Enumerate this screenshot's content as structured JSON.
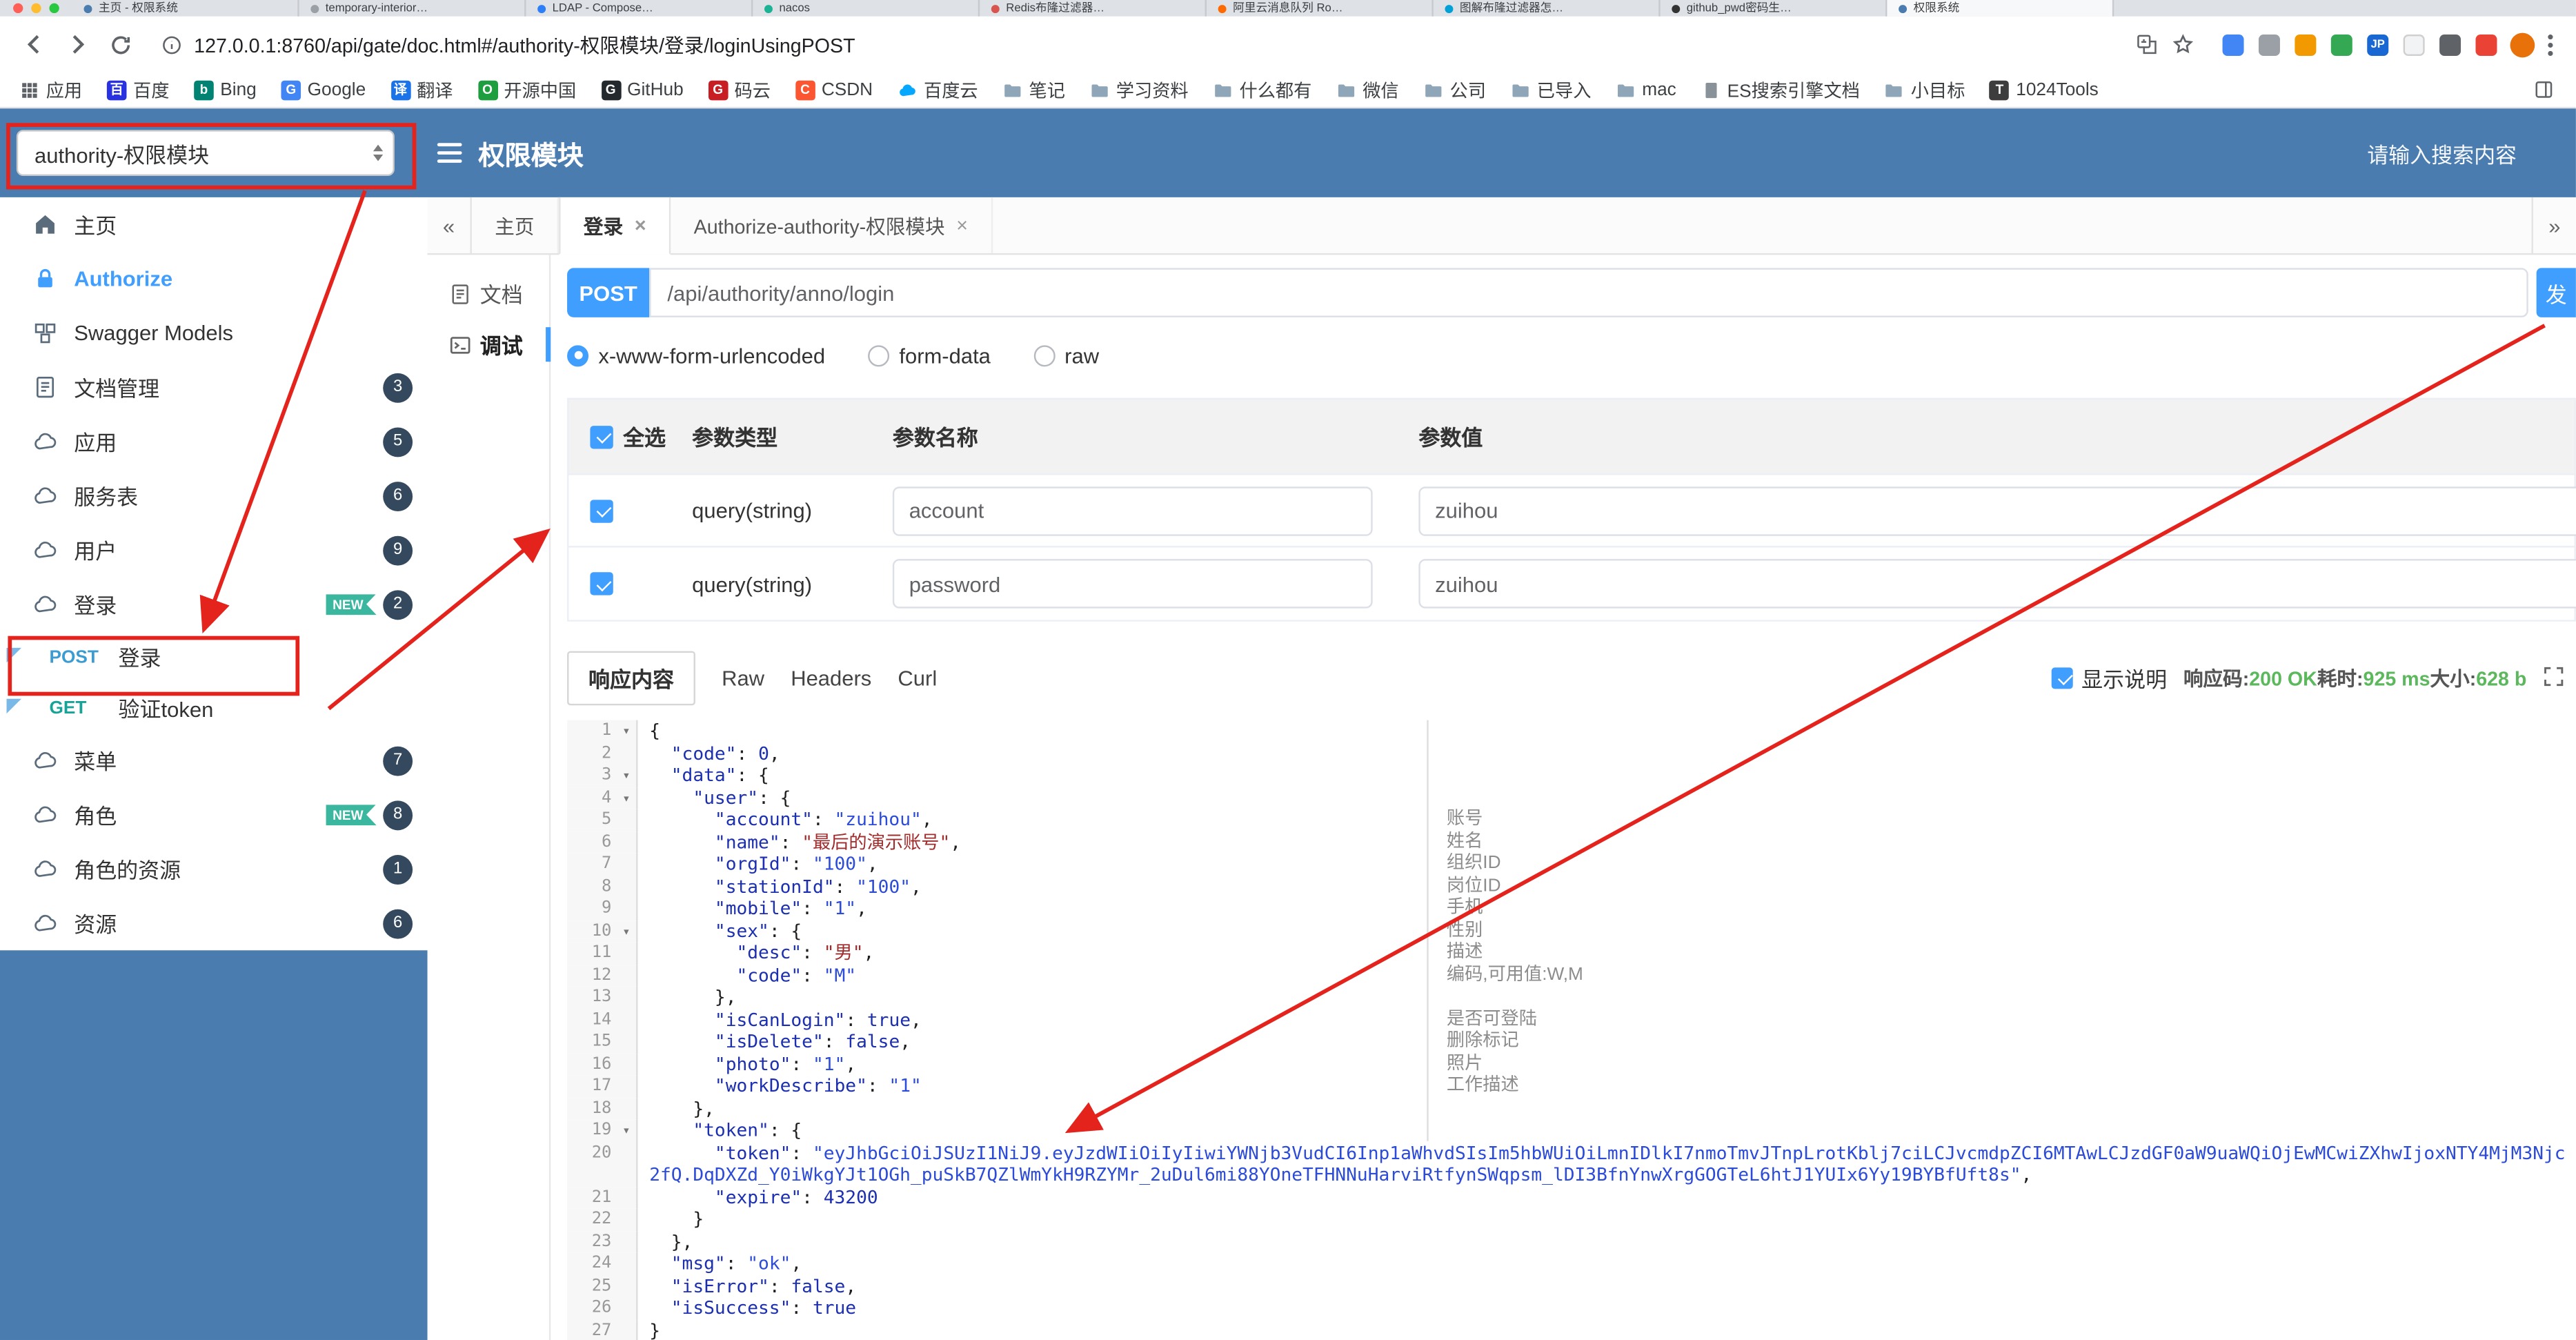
{
  "colors": {
    "accent": "#409eff",
    "header": "#4a7caf",
    "badge": "#35495e",
    "newtag": "#3bb7a0",
    "success": "#5cb85c",
    "mpost": "#3a9cd2",
    "mget": "#17a398",
    "red": "#e4231d"
  },
  "browser": {
    "tabs": [
      {
        "title": "主页 - 权限系统",
        "color": "#4a7caf"
      },
      {
        "title": "temporary-interior…",
        "color": "#9aa0a6"
      },
      {
        "title": "LDAP - Compose…",
        "color": "#2d7ff9"
      },
      {
        "title": "nacos",
        "color": "#1ab394"
      },
      {
        "title": "Redis布隆过滤器…",
        "color": "#d9544f"
      },
      {
        "title": "阿里云消息队列 Ro…",
        "color": "#ff6a00"
      },
      {
        "title": "图解布隆过滤器怎…",
        "color": "#00a1d6"
      },
      {
        "title": "github_pwd密码生…",
        "color": "#333333"
      },
      {
        "title": "权限系统",
        "color": "#4a7caf",
        "active": true
      }
    ],
    "url": "127.0.0.1:8760/api/gate/doc.html#/authority-权限模块/登录/loginUsingPOST",
    "bookmarks": [
      {
        "label": "应用",
        "icon": "grid"
      },
      {
        "label": "百度",
        "icon": "letter",
        "letter": "百",
        "color": "#2932e1"
      },
      {
        "label": "Bing",
        "icon": "letter",
        "letter": "b",
        "color": "#008373"
      },
      {
        "label": "Google",
        "icon": "letter",
        "letter": "G",
        "color": "#4285f4"
      },
      {
        "label": "翻译",
        "icon": "letter",
        "letter": "译",
        "color": "#1a73e8"
      },
      {
        "label": "开源中国",
        "icon": "letter",
        "letter": "O",
        "color": "#1e9e3e"
      },
      {
        "label": "GitHub",
        "icon": "letter",
        "letter": "G",
        "color": "#24292e"
      },
      {
        "label": "码云",
        "icon": "letter",
        "letter": "G",
        "color": "#c71d23"
      },
      {
        "label": "CSDN",
        "icon": "letter",
        "letter": "C",
        "color": "#fc5531"
      },
      {
        "label": "百度云",
        "icon": "cloud"
      },
      {
        "label": "笔记",
        "icon": "folder"
      },
      {
        "label": "学习资料",
        "icon": "folder"
      },
      {
        "label": "什么都有",
        "icon": "folder"
      },
      {
        "label": "微信",
        "icon": "folder"
      },
      {
        "label": "公司",
        "icon": "folder"
      },
      {
        "label": "已导入",
        "icon": "folder"
      },
      {
        "label": "mac",
        "icon": "folder"
      },
      {
        "label": "ES搜索引擎文档",
        "icon": "doc"
      },
      {
        "label": "小目标",
        "icon": "folder"
      },
      {
        "label": "1024Tools",
        "icon": "letter",
        "letter": "T",
        "color": "#3d3d3d"
      }
    ],
    "extensions": [
      {
        "color": "#4285f4"
      },
      {
        "color": "#9aa0a6"
      },
      {
        "color": "#f29900"
      },
      {
        "color": "#34a853"
      },
      {
        "color": "#1967d2",
        "label": "JP"
      },
      {
        "color": "#f1f3f4"
      },
      {
        "color": "#5f6368"
      },
      {
        "color": "#ea4335"
      }
    ]
  },
  "header": {
    "module_select": "authority-权限模块",
    "title": "权限模块",
    "search_placeholder": "请输入搜索内容"
  },
  "sidebar": {
    "new_tag": "NEW",
    "items": [
      {
        "key": "home",
        "label": "主页",
        "icon": "home"
      },
      {
        "key": "authorize",
        "label": "Authorize",
        "icon": "lock",
        "link": true
      },
      {
        "key": "swagger-models",
        "label": "Swagger Models",
        "icon": "models"
      },
      {
        "key": "doc-manage",
        "label": "文档管理",
        "icon": "doc",
        "badge": "3"
      },
      {
        "key": "app",
        "label": "应用",
        "icon": "cloud",
        "badge": "5"
      },
      {
        "key": "service",
        "label": "服务表",
        "icon": "cloud",
        "badge": "6"
      },
      {
        "key": "user",
        "label": "用户",
        "icon": "cloud",
        "badge": "9"
      },
      {
        "key": "login",
        "label": "登录",
        "icon": "cloud",
        "badge": "2",
        "new": true,
        "children": [
          {
            "key": "login-post",
            "method": "POST",
            "label": "登录"
          },
          {
            "key": "verify-token-get",
            "method": "GET",
            "label": "验证token"
          }
        ]
      },
      {
        "key": "menu",
        "label": "菜单",
        "icon": "cloud",
        "badge": "7"
      },
      {
        "key": "role",
        "label": "角色",
        "icon": "cloud",
        "badge": "8",
        "new": true
      },
      {
        "key": "role-resource",
        "label": "角色的资源",
        "icon": "cloud",
        "badge": "1"
      },
      {
        "key": "resource",
        "label": "资源",
        "icon": "cloud",
        "badge": "6"
      }
    ]
  },
  "app_tabs": {
    "collapse": "«",
    "expand": "»",
    "tabs": [
      {
        "label": "主页"
      },
      {
        "label": "登录",
        "closable": true,
        "active": true
      },
      {
        "label": "Authorize-authority-权限模块",
        "closable": true
      }
    ]
  },
  "ui": {
    "close_glyph": "×",
    "fold_glyph": "▾"
  },
  "doc_tabs": [
    {
      "label": "文档"
    },
    {
      "label": "调试",
      "active": true
    }
  ],
  "request": {
    "method": "POST",
    "url": "/api/authority/anno/login",
    "send_label": "发",
    "body_types": [
      "x-www-form-urlencoded",
      "form-data",
      "raw"
    ],
    "selected_body_type": "x-www-form-urlencoded",
    "table": {
      "select_all_label": "全选",
      "headers": [
        "参数类型",
        "参数名称",
        "参数值"
      ],
      "rows": [
        {
          "checked": true,
          "type": "query(string)",
          "name": "account",
          "value": "zuihou"
        },
        {
          "checked": true,
          "type": "query(string)",
          "name": "password",
          "value": "zuihou"
        }
      ]
    }
  },
  "response": {
    "tabs": [
      "响应内容",
      "Raw",
      "Headers",
      "Curl"
    ],
    "active_tab": "响应内容",
    "show_desc_label": "显示说明",
    "meta": [
      {
        "label": "响应码:",
        "value": "200 OK"
      },
      {
        "label": "耗时:",
        "value": "925 ms"
      },
      {
        "label": "大小:",
        "value": "628 b"
      }
    ],
    "fold_lines": [
      1,
      3,
      4,
      10,
      19
    ],
    "lines": [
      "{",
      "  \"code\": 0,",
      "  \"data\": {",
      "    \"user\": {",
      "      \"account\": \"zuihou\",",
      "      \"name\": \"最后的演示账号\",",
      "      \"orgId\": \"100\",",
      "      \"stationId\": \"100\",",
      "      \"mobile\": \"1\",",
      "      \"sex\": {",
      "        \"desc\": \"男\",",
      "        \"code\": \"M\"",
      "      },",
      "      \"isCanLogin\": true,",
      "      \"isDelete\": false,",
      "      \"photo\": \"1\",",
      "      \"workDescribe\": \"1\"",
      "    },",
      "    \"token\": {",
      "      \"token\": \"eyJhbGciOiJSUzI1NiJ9.eyJzdWIiOiIyIiwiYWNjb3VudCI6Inp1aWhvdSIsIm5hbWUiOiLmnIDlkI7nmoTmvJTnpLrotKblj7ciLCJvcmdpZCI6MTAwLCJzdGF0aW9uaWQiOjEwMCwiZXhwIjoxNTY4MjM3Njc2fQ.DqDXZd_Y0iWkgYJt1OGh_puSkB7QZlWmYkH9RZYMr_2uDul6mi88YOneTFHNNuHarviRtfynSWqpsm_lDI3BfnYnwXrgGOGTeL6htJ1YUIx6Yy19BYBfUft8s\",",
      "      \"expire\": 43200",
      "    }",
      "  },",
      "  \"msg\": \"ok\",",
      "  \"isError\": false,",
      "  \"isSuccess\": true",
      "}"
    ],
    "annotations": [
      {
        "line": 5,
        "text": "账号"
      },
      {
        "line": 6,
        "text": "姓名"
      },
      {
        "line": 7,
        "text": "组织ID"
      },
      {
        "line": 8,
        "text": "岗位ID"
      },
      {
        "line": 9,
        "text": "手机"
      },
      {
        "line": 10,
        "text": "性别"
      },
      {
        "line": 11,
        "text": "描述"
      },
      {
        "line": 12,
        "text": "编码,可用值:W,M"
      },
      {
        "line": 14,
        "text": "是否可登陆"
      },
      {
        "line": 15,
        "text": "删除标记"
      },
      {
        "line": 16,
        "text": "照片"
      },
      {
        "line": 17,
        "text": "工作描述"
      }
    ]
  }
}
